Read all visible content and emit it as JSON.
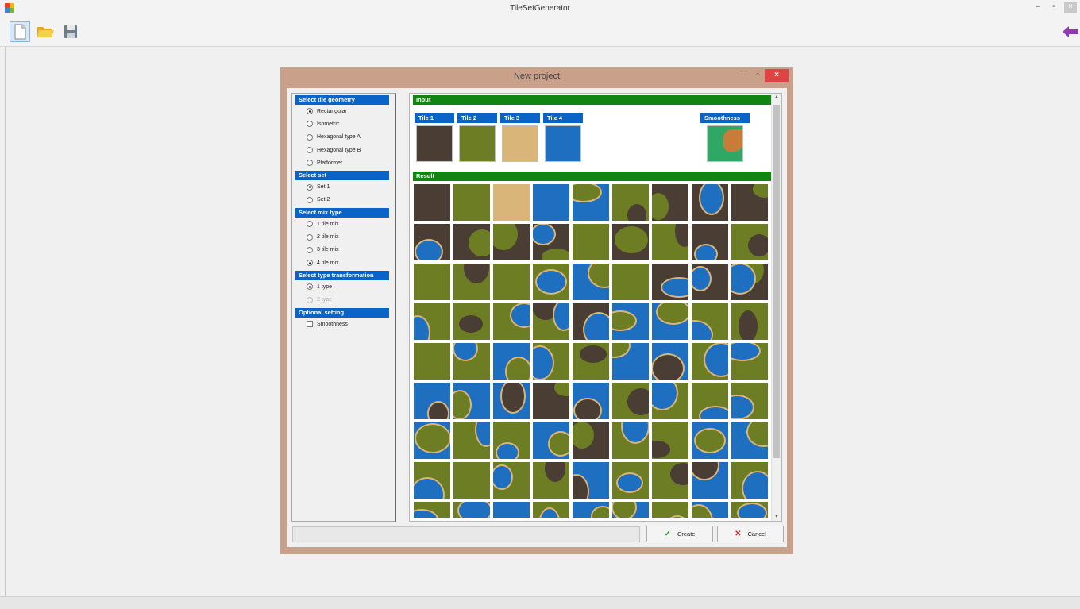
{
  "app": {
    "title": "TileSetGenerator"
  },
  "window_controls": {
    "minimize": "–",
    "maximize": "▫",
    "close": "×"
  },
  "toolbar": {
    "buttons": [
      "new-file-icon",
      "open-folder-icon",
      "save-disk-icon"
    ],
    "right_icon": "back-arrow-icon"
  },
  "dialog": {
    "title": "New project",
    "controls": {
      "minimize": "–",
      "maximize": "▫",
      "close": "×"
    },
    "sections": [
      {
        "header": "Select tile geometry",
        "type": "radio",
        "options": [
          {
            "label": "Rectangular",
            "checked": true,
            "disabled": false
          },
          {
            "label": "Isometric",
            "checked": false,
            "disabled": false
          },
          {
            "label": "Hexagonal type A",
            "checked": false,
            "disabled": false
          },
          {
            "label": "Hexagonal type B",
            "checked": false,
            "disabled": false
          },
          {
            "label": "Platformer",
            "checked": false,
            "disabled": false
          }
        ]
      },
      {
        "header": "Select set",
        "type": "radio",
        "options": [
          {
            "label": "Set 1",
            "checked": true,
            "disabled": false
          },
          {
            "label": "Set 2",
            "checked": false,
            "disabled": false
          }
        ]
      },
      {
        "header": "Select mix type",
        "type": "radio",
        "options": [
          {
            "label": "1 tile mix",
            "checked": false,
            "disabled": false
          },
          {
            "label": "2 tile mix",
            "checked": false,
            "disabled": false
          },
          {
            "label": "3 tile mix",
            "checked": false,
            "disabled": false
          },
          {
            "label": "4 tile mix",
            "checked": true,
            "disabled": false
          }
        ]
      },
      {
        "header": "Select type transformation",
        "type": "radio",
        "options": [
          {
            "label": "1 type",
            "checked": true,
            "disabled": false
          },
          {
            "label": "2 type",
            "checked": false,
            "disabled": true
          }
        ]
      },
      {
        "header": "Optional setting",
        "type": "checkbox",
        "options": [
          {
            "label": "Smoothness",
            "checked": false,
            "disabled": false
          }
        ]
      }
    ],
    "input_header": "Input",
    "tiles": [
      {
        "label": "Tile 1",
        "color": "#4a3d33"
      },
      {
        "label": "Tile 2",
        "color": "#6c7d24"
      },
      {
        "label": "Tile 3",
        "color": "#d9b57a"
      },
      {
        "label": "Tile 4",
        "color": "#1f6fc0"
      }
    ],
    "smoothness_label": "Smoothness",
    "smoothness_colors": [
      "#2fa866",
      "#c97b3a"
    ],
    "result_header": "Result",
    "result_grid": {
      "columns": 9,
      "rows": [
        [
          "d",
          "g",
          "s",
          "w",
          "wg",
          "gd",
          "dg",
          "dw",
          "dg"
        ],
        [
          "dw",
          "dg",
          "dg",
          "dgw",
          "g",
          "dg",
          "gd",
          "dw",
          "gd"
        ],
        [
          "g",
          "gd",
          "g",
          "gw",
          "wg",
          "g",
          "dw",
          "dw",
          "dgw"
        ],
        [
          "gw",
          "gd",
          "gw",
          "gdw",
          "dw",
          "wg",
          "wg",
          "gw",
          "gd"
        ],
        [
          "g",
          "gw",
          "wg",
          "gw",
          "gd",
          "wg",
          "wd",
          "gw",
          "gw"
        ],
        [
          "wd",
          "wg",
          "wd",
          "dg",
          "wd",
          "gd",
          "gw",
          "gw",
          "gw"
        ],
        [
          "wg",
          "gw",
          "gw",
          "wg",
          "dg",
          "gw",
          "gd",
          "wg",
          "wg"
        ],
        [
          "gw",
          "g",
          "gw",
          "gd",
          "wd",
          "gw",
          "gd",
          "wd",
          "gw"
        ],
        [
          "gw",
          "gw",
          "wg",
          "gw",
          "wg",
          "wg",
          "gw",
          "wg",
          "gw"
        ]
      ]
    },
    "create_label": "Create",
    "cancel_label": "Cancel",
    "create_icon": "check-icon",
    "cancel_icon": "close-x-icon"
  }
}
